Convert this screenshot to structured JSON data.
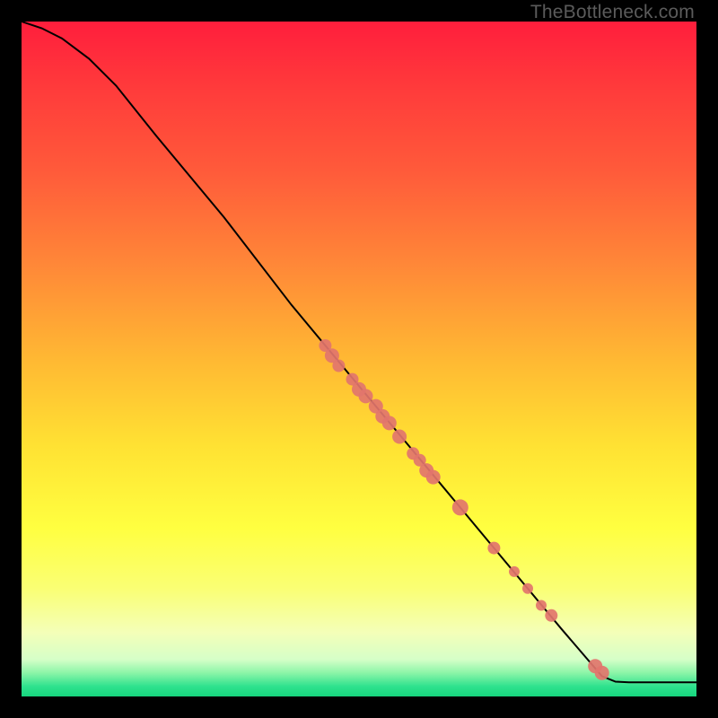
{
  "watermark": "TheBottleneck.com",
  "chart_data": {
    "type": "line",
    "title": "",
    "xlabel": "",
    "ylabel": "",
    "xlim": [
      0,
      100
    ],
    "ylim": [
      0,
      100
    ],
    "grid": false,
    "series": [
      {
        "name": "curve",
        "type": "line",
        "color": "#000000",
        "points": [
          {
            "x": 0,
            "y": 100
          },
          {
            "x": 3,
            "y": 99
          },
          {
            "x": 6,
            "y": 97.5
          },
          {
            "x": 10,
            "y": 94.5
          },
          {
            "x": 14,
            "y": 90.5
          },
          {
            "x": 20,
            "y": 83
          },
          {
            "x": 30,
            "y": 71
          },
          {
            "x": 40,
            "y": 58
          },
          {
            "x": 50,
            "y": 46
          },
          {
            "x": 60,
            "y": 34
          },
          {
            "x": 70,
            "y": 22
          },
          {
            "x": 80,
            "y": 10
          },
          {
            "x": 86,
            "y": 3
          },
          {
            "x": 88,
            "y": 2.2
          },
          {
            "x": 90,
            "y": 2.1
          },
          {
            "x": 100,
            "y": 2.1
          }
        ]
      },
      {
        "name": "markers",
        "type": "scatter",
        "color": "#e2756c",
        "points": [
          {
            "x": 45,
            "y": 52,
            "r": 7
          },
          {
            "x": 46,
            "y": 50.5,
            "r": 8
          },
          {
            "x": 47,
            "y": 49,
            "r": 7
          },
          {
            "x": 49,
            "y": 47,
            "r": 7
          },
          {
            "x": 50,
            "y": 45.5,
            "r": 8
          },
          {
            "x": 51,
            "y": 44.5,
            "r": 8
          },
          {
            "x": 52.5,
            "y": 43,
            "r": 8
          },
          {
            "x": 53.5,
            "y": 41.5,
            "r": 8
          },
          {
            "x": 54.5,
            "y": 40.5,
            "r": 8
          },
          {
            "x": 56,
            "y": 38.5,
            "r": 8
          },
          {
            "x": 58,
            "y": 36,
            "r": 7
          },
          {
            "x": 59,
            "y": 35,
            "r": 7
          },
          {
            "x": 60,
            "y": 33.5,
            "r": 8
          },
          {
            "x": 61,
            "y": 32.5,
            "r": 8
          },
          {
            "x": 65,
            "y": 28,
            "r": 9
          },
          {
            "x": 70,
            "y": 22,
            "r": 7
          },
          {
            "x": 73,
            "y": 18.5,
            "r": 6
          },
          {
            "x": 75,
            "y": 16,
            "r": 6
          },
          {
            "x": 77,
            "y": 13.5,
            "r": 6
          },
          {
            "x": 78.5,
            "y": 12,
            "r": 7
          },
          {
            "x": 85,
            "y": 4.5,
            "r": 8
          },
          {
            "x": 86,
            "y": 3.5,
            "r": 8
          }
        ]
      }
    ],
    "gradient_stops": [
      {
        "offset": 0.0,
        "color": "#ff1e3c"
      },
      {
        "offset": 0.1,
        "color": "#ff3b3b"
      },
      {
        "offset": 0.22,
        "color": "#ff5a3a"
      },
      {
        "offset": 0.35,
        "color": "#ff8438"
      },
      {
        "offset": 0.5,
        "color": "#ffb833"
      },
      {
        "offset": 0.63,
        "color": "#ffe233"
      },
      {
        "offset": 0.75,
        "color": "#ffff40"
      },
      {
        "offset": 0.84,
        "color": "#faff74"
      },
      {
        "offset": 0.905,
        "color": "#f4ffb8"
      },
      {
        "offset": 0.945,
        "color": "#d6ffc8"
      },
      {
        "offset": 0.965,
        "color": "#8cf5a8"
      },
      {
        "offset": 0.985,
        "color": "#2fe28e"
      },
      {
        "offset": 1.0,
        "color": "#16d67e"
      }
    ]
  }
}
